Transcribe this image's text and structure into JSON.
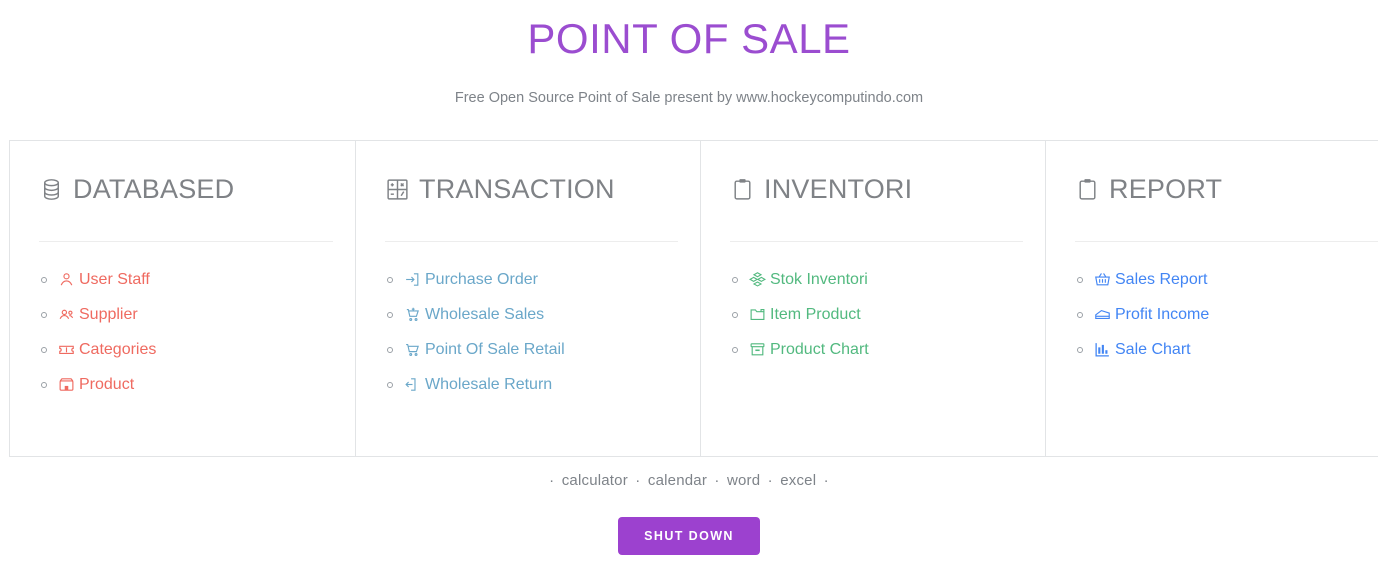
{
  "header": {
    "title": "POINT OF SALE",
    "subtitle": "Free Open Source Point of Sale present by www.hockeycomputindo.com",
    "title_color": "#9b4dd0",
    "subtitle_color": "#7e8389"
  },
  "columns": [
    {
      "key": "databased",
      "title": "DATABASED",
      "icon": "database-icon",
      "accent": "#ef6a60",
      "items": [
        {
          "label": "User Staff",
          "icon": "user-icon"
        },
        {
          "label": "Supplier",
          "icon": "users-group-icon"
        },
        {
          "label": "Categories",
          "icon": "ticket-icon"
        },
        {
          "label": "Product",
          "icon": "box-icon"
        }
      ]
    },
    {
      "key": "transaction",
      "title": "TRANSACTION",
      "icon": "calculator-icon",
      "accent": "#6aa7c9",
      "items": [
        {
          "label": "Purchase Order",
          "icon": "login-arrow-icon"
        },
        {
          "label": "Wholesale Sales",
          "icon": "cart-plus-icon"
        },
        {
          "label": "Point Of Sale Retail",
          "icon": "shopping-cart-icon"
        },
        {
          "label": "Wholesale Return",
          "icon": "logout-arrow-icon"
        }
      ]
    },
    {
      "key": "inventori",
      "title": "INVENTORI",
      "icon": "clipboard-icon",
      "accent": "#52b97f",
      "items": [
        {
          "label": "Stok Inventori",
          "icon": "boxes-stack-icon"
        },
        {
          "label": "Item Product",
          "icon": "folder-icon"
        },
        {
          "label": "Product Chart",
          "icon": "archive-box-icon"
        }
      ]
    },
    {
      "key": "report",
      "title": "REPORT",
      "icon": "clipboard-icon",
      "accent": "#4285f4",
      "items": [
        {
          "label": "Sales Report",
          "icon": "basket-icon"
        },
        {
          "label": "Profit Income",
          "icon": "money-icon"
        },
        {
          "label": "Sale Chart",
          "icon": "bar-chart-icon"
        }
      ]
    }
  ],
  "footer": {
    "lead_bullet": "·",
    "links": [
      "calculator",
      "calendar",
      "word",
      "excel"
    ],
    "separator": "·",
    "trail_bullet": "·",
    "shutdown_label": "SHUT DOWN",
    "shutdown_color": "#9c41cf"
  }
}
